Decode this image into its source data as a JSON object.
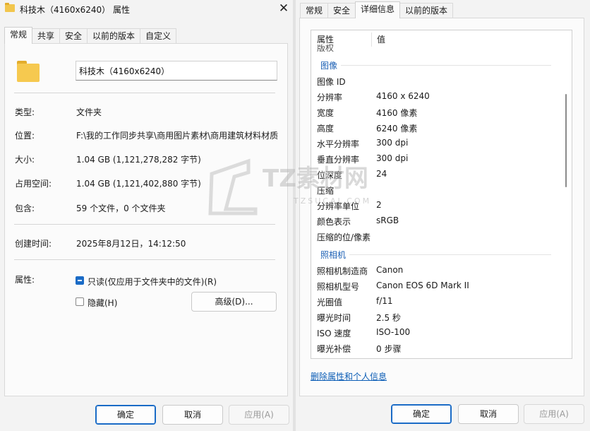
{
  "left_window": {
    "title": "科技木（4160x6240） 属性",
    "close_label": "✕",
    "tabs": [
      "常规",
      "共享",
      "安全",
      "以前的版本",
      "自定义"
    ],
    "name_value": "科技木（4160x6240）",
    "rows": {
      "type_label": "类型:",
      "type_value": "文件夹",
      "location_label": "位置:",
      "location_value": "F:\\我的工作同步共享\\商用图片素材\\商用建筑材料材质",
      "size_label": "大小:",
      "size_value": "1.04 GB (1,121,278,282 字节)",
      "disk_label": "占用空间:",
      "disk_value": "1.04 GB (1,121,402,880 字节)",
      "contains_label": "包含:",
      "contains_value": "59 个文件，0 个文件夹",
      "created_label": "创建时间:",
      "created_value": "2025年8月12日，14:12:50",
      "attr_label": "属性:"
    },
    "readonly_label": "只读(仅应用于文件夹中的文件)(R)",
    "readonly_checked": true,
    "hidden_label": "隐藏(H)",
    "hidden_checked": false,
    "advanced_label": "高级(D)...",
    "ok_label": "确定",
    "cancel_label": "取消",
    "apply_label": "应用(A)"
  },
  "right_window": {
    "tabs": [
      "常规",
      "安全",
      "详细信息",
      "以前的版本"
    ],
    "header_property": "属性",
    "header_value": "值",
    "cut_row_text": "版权",
    "section_image": "图像",
    "image_rows": [
      {
        "k": "图像 ID",
        "v": ""
      },
      {
        "k": "分辨率",
        "v": "4160 x 6240"
      },
      {
        "k": "宽度",
        "v": "4160 像素"
      },
      {
        "k": "高度",
        "v": "6240 像素"
      },
      {
        "k": "水平分辨率",
        "v": "300 dpi"
      },
      {
        "k": "垂直分辨率",
        "v": "300 dpi"
      },
      {
        "k": "位深度",
        "v": "24"
      },
      {
        "k": "压缩",
        "v": ""
      },
      {
        "k": "分辨率单位",
        "v": "2"
      },
      {
        "k": "颜色表示",
        "v": "sRGB"
      },
      {
        "k": "压缩的位/像素",
        "v": ""
      }
    ],
    "section_camera": "照相机",
    "camera_rows": [
      {
        "k": "照相机制造商",
        "v": "Canon"
      },
      {
        "k": "照相机型号",
        "v": "Canon EOS 6D Mark II"
      },
      {
        "k": "光圈值",
        "v": "f/11"
      },
      {
        "k": "曝光时间",
        "v": "2.5 秒"
      },
      {
        "k": "ISO 速度",
        "v": "ISO-100"
      },
      {
        "k": "曝光补偿",
        "v": "0 步骤"
      }
    ],
    "remove_link": "删除属性和个人信息",
    "ok_label": "确定",
    "cancel_label": "取消",
    "apply_label": "应用(A)"
  },
  "watermark": {
    "brand": "TZ素材网",
    "url": "TZSUCAI.COM"
  },
  "colors": {
    "accent": "#1a6bc6",
    "link": "#0b5db6",
    "section": "#1a5fb4",
    "folder": "#f6c94f"
  }
}
